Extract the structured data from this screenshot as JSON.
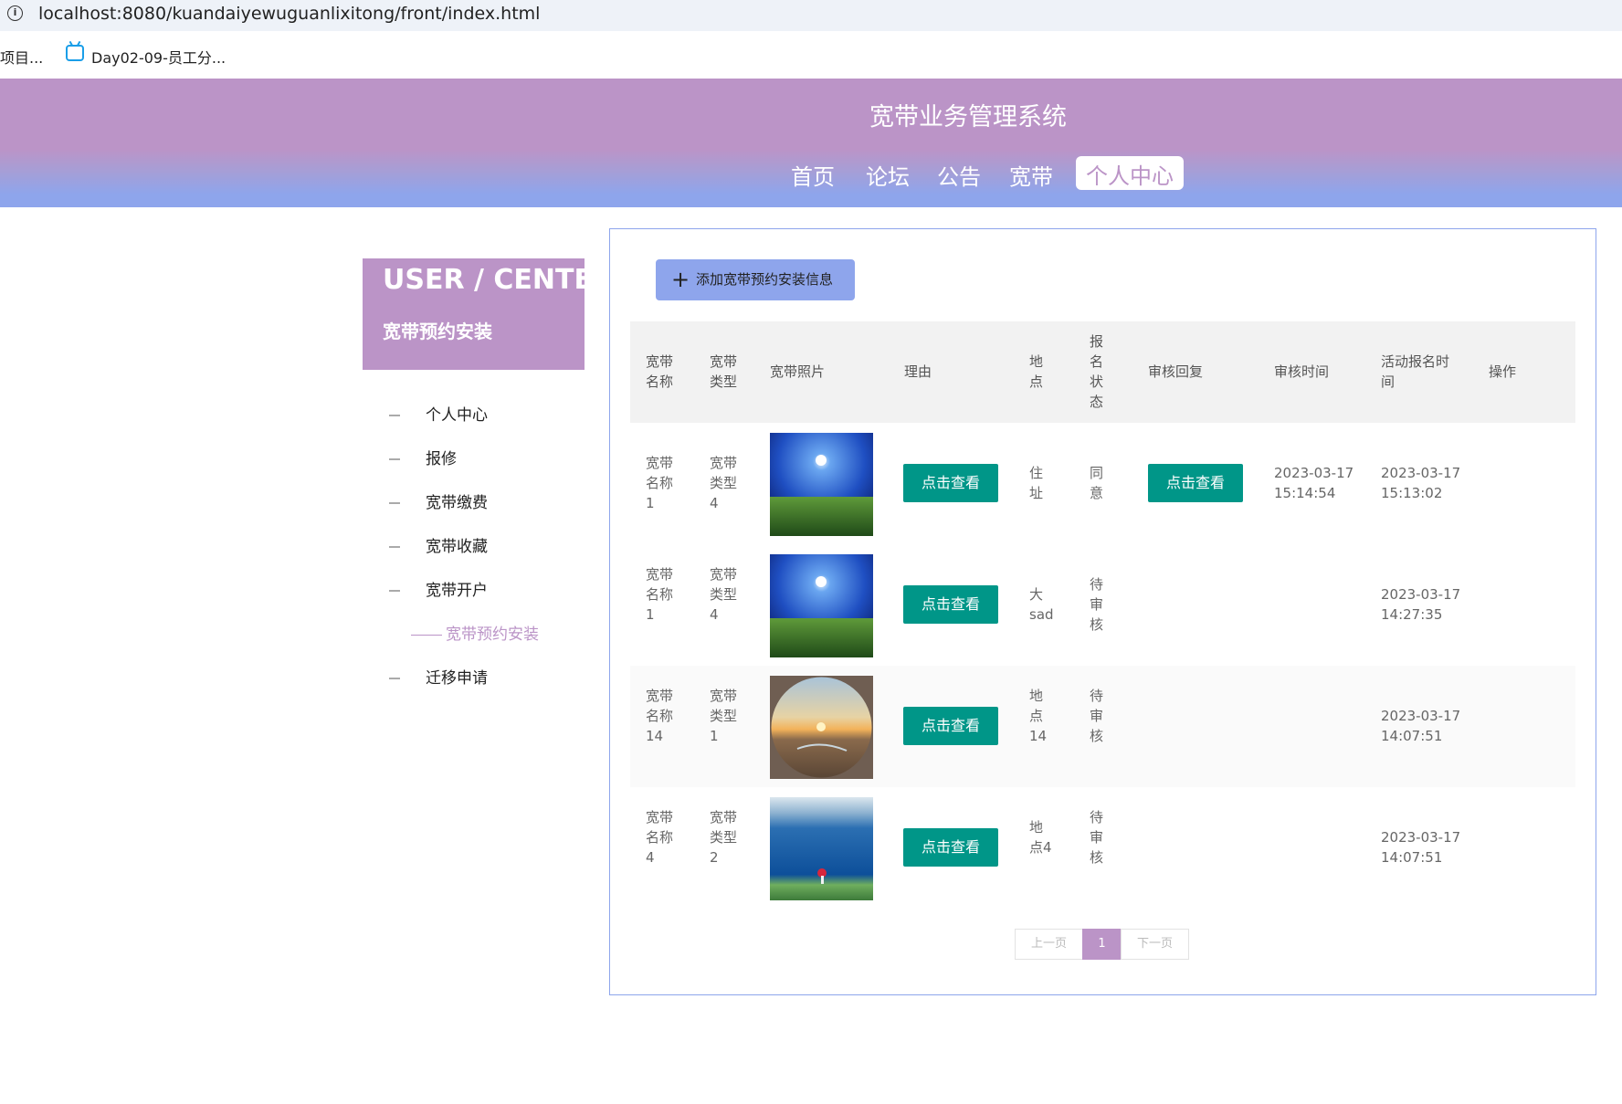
{
  "browser": {
    "info_glyph": "i",
    "url": "localhost:8080/kuandaiyewuguanlixitong/front/index.html",
    "bookmark_1": "项目...",
    "bookmark_2": "Day02-09-员工分..."
  },
  "header": {
    "title": "宽带业务管理系统",
    "nav": [
      "首页",
      "论坛",
      "公告",
      "宽带",
      "个人中心"
    ],
    "active_nav": "个人中心"
  },
  "sidebar": {
    "title_en": "USER / CENTER",
    "title_cn": "宽带预约安装",
    "items": [
      "个人中心",
      "报修",
      "宽带缴费",
      "宽带收藏",
      "宽带开户"
    ],
    "sub_item": "宽带预约安装",
    "last_item": "迁移申请"
  },
  "toolbar": {
    "add_plus": "+",
    "add_label": "添加宽带预约安装信息"
  },
  "table": {
    "headers": {
      "name": "宽带名称",
      "type": "宽带类型",
      "photo": "宽带照片",
      "reason": "理由",
      "location": "地点",
      "status": "报名状态",
      "reply": "审核回复",
      "review_time": "审核时间",
      "signup_time": "活动报名时间",
      "action": "操作"
    },
    "view_label": "点击查看",
    "rows": [
      {
        "name": "宽带名称1",
        "type": "宽带类型4",
        "photo": "sky-grass",
        "location": "住址",
        "status": "同意",
        "has_reply": true,
        "review_date": "2023-03-17",
        "review_clock": "15:14:54",
        "signup_date": "2023-03-17",
        "signup_clock": "15:13:02"
      },
      {
        "name": "宽带名称1",
        "type": "宽带类型4",
        "photo": "sky-grass",
        "location": "大sad",
        "status": "待审核",
        "has_reply": false,
        "review_date": "",
        "review_clock": "",
        "signup_date": "2023-03-17",
        "signup_clock": "14:27:35"
      },
      {
        "name": "宽带名称14",
        "type": "宽带类型1",
        "photo": "desert-sunset",
        "location": "地点14",
        "status": "待审核",
        "has_reply": false,
        "review_date": "",
        "review_clock": "",
        "signup_date": "2023-03-17",
        "signup_clock": "14:07:51"
      },
      {
        "name": "宽带名称4",
        "type": "宽带类型2",
        "photo": "blue-lake",
        "location": "地点4",
        "status": "待审核",
        "has_reply": false,
        "review_date": "",
        "review_clock": "",
        "signup_date": "2023-03-17",
        "signup_clock": "14:07:51"
      }
    ]
  },
  "pagination": {
    "prev": "上一页",
    "current": "1",
    "next": "下一页"
  },
  "colors": {
    "brand": "#bb94c7",
    "accent": "#8ea5ec",
    "button": "#009688"
  }
}
